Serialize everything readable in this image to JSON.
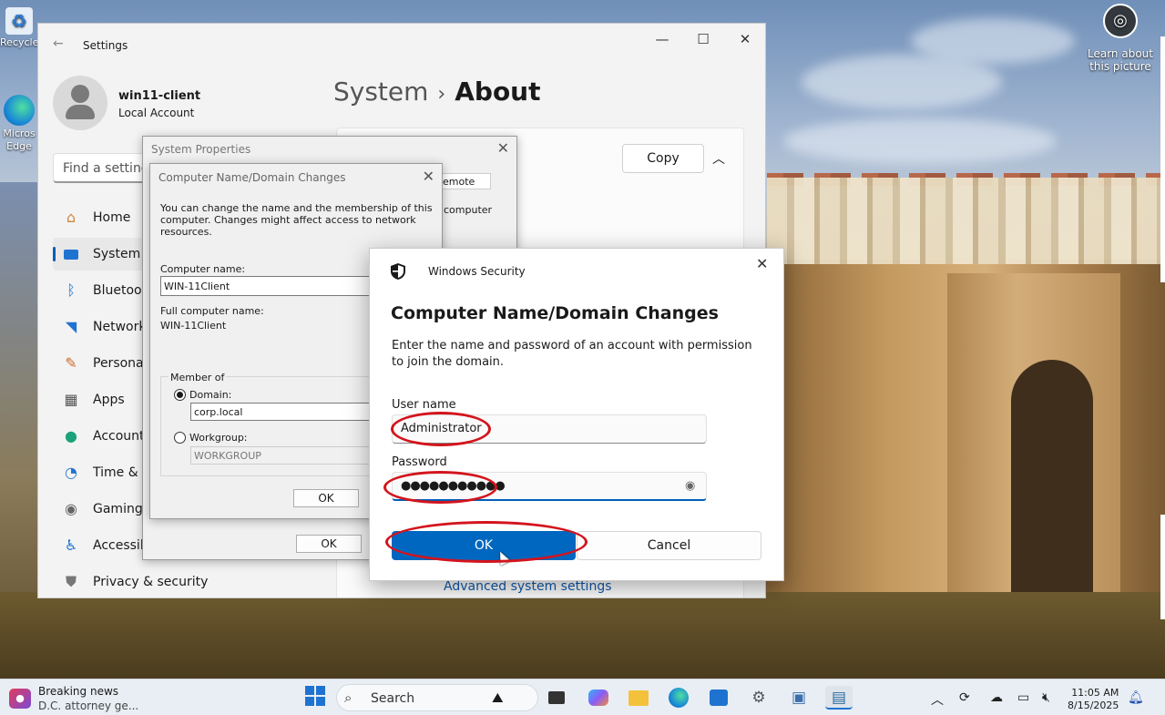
{
  "desktop": {
    "icons": [
      {
        "label": "Recycle",
        "icon": "recycle-bin-icon"
      },
      {
        "label": "Micros Edge",
        "icon": "edge-icon"
      }
    ],
    "learn_about_picture": "Learn about this picture"
  },
  "settings": {
    "app_title": "Settings",
    "user": {
      "name": "win11-client",
      "account_type": "Local Account"
    },
    "search_placeholder": "Find a setting",
    "nav": [
      {
        "label": "Home",
        "icon": "home-icon"
      },
      {
        "label": "System",
        "icon": "system-icon",
        "active": true
      },
      {
        "label": "Bluetooth",
        "icon": "bluetooth-icon"
      },
      {
        "label": "Network",
        "icon": "network-icon"
      },
      {
        "label": "Personali",
        "icon": "brush-icon"
      },
      {
        "label": "Apps",
        "icon": "apps-icon"
      },
      {
        "label": "Accounts",
        "icon": "accounts-icon"
      },
      {
        "label": "Time & la",
        "icon": "clock-icon"
      },
      {
        "label": "Gaming",
        "icon": "gamepad-icon"
      },
      {
        "label": "Accessibi",
        "icon": "accessibility-icon"
      },
      {
        "label": "Privacy & security",
        "icon": "shield-icon"
      }
    ],
    "breadcrumb": {
      "parent": "System",
      "separator": "›",
      "current": "About"
    },
    "copy_button": "Copy",
    "advanced_link": "Advanced system settings"
  },
  "system_properties": {
    "title": "System Properties",
    "tab_fragment": "emote",
    "text_fragment": "computer",
    "ok": "OK"
  },
  "computer_name_dialog": {
    "title": "Computer Name/Domain Changes",
    "description": "You can change the name and the membership of this computer. Changes might affect access to network resources.",
    "computer_name_label": "Computer name:",
    "computer_name_value": "WIN-11Client",
    "full_name_label": "Full computer name:",
    "full_name_value": "WIN-11Client",
    "member_of_label": "Member of",
    "domain_label": "Domain:",
    "domain_value": "corp.local",
    "workgroup_label": "Workgroup:",
    "workgroup_value": "WORKGROUP",
    "ok": "OK"
  },
  "windows_security": {
    "title": "Windows Security",
    "heading": "Computer Name/Domain Changes",
    "instruction": "Enter the name and password of an account with permission to join the domain.",
    "username_label": "User name",
    "username_value": "Administrator",
    "password_label": "Password",
    "password_value": "●●●●●●●●●●●",
    "ok": "OK",
    "cancel": "Cancel"
  },
  "taskbar": {
    "news_title": "Breaking news",
    "news_subtitle": "D.C. attorney ge...",
    "search_label": "Search",
    "time": "11:05 AM",
    "date": "8/15/2025"
  },
  "colors": {
    "accent": "#0067c0",
    "annotation": "#d3141c"
  }
}
